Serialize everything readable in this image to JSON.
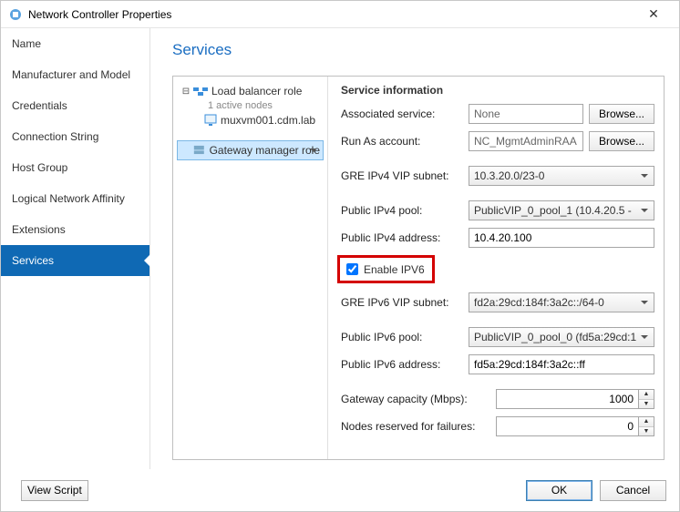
{
  "window": {
    "title": "Network Controller Properties"
  },
  "sidebar": {
    "items": [
      {
        "label": "Name"
      },
      {
        "label": "Manufacturer and Model"
      },
      {
        "label": "Credentials"
      },
      {
        "label": "Connection String"
      },
      {
        "label": "Host Group"
      },
      {
        "label": "Logical Network Affinity"
      },
      {
        "label": "Extensions"
      },
      {
        "label": "Services"
      }
    ],
    "selected_index": 7
  },
  "content_title": "Services",
  "tree": {
    "role1_label": "Load balancer role",
    "role1_sub": "1 active nodes",
    "role1_node": "muxvm001.cdm.lab",
    "role2_label": "Gateway manager role"
  },
  "form": {
    "header": "Service information",
    "assoc_label": "Associated service:",
    "assoc_value": "None",
    "browse_label": "Browse...",
    "runas_label": "Run As account:",
    "runas_value": "NC_MgmtAdminRAA",
    "gre4_label": "GRE IPv4 VIP subnet:",
    "gre4_value": "10.3.20.0/23-0",
    "pool4_label": "Public IPv4 pool:",
    "pool4_value": "PublicVIP_0_pool_1 (10.4.20.5 - ",
    "addr4_label": "Public IPv4 address:",
    "addr4_value": "10.4.20.100",
    "ipv6_check_label": "Enable IPV6",
    "ipv6_checked": true,
    "gre6_label": "GRE IPv6 VIP subnet:",
    "gre6_value": "fd2a:29cd:184f:3a2c::/64-0",
    "pool6_label": "Public IPv6 pool:",
    "pool6_value": "PublicVIP_0_pool_0 (fd5a:29cd:1",
    "addr6_label": "Public IPv6 address:",
    "addr6_value": "fd5a:29cd:184f:3a2c::ff",
    "cap_label": "Gateway capacity (Mbps):",
    "cap_value": "1000",
    "nodes_label": "Nodes reserved for failures:",
    "nodes_value": "0"
  },
  "footer": {
    "view_script": "View Script",
    "ok": "OK",
    "cancel": "Cancel"
  }
}
